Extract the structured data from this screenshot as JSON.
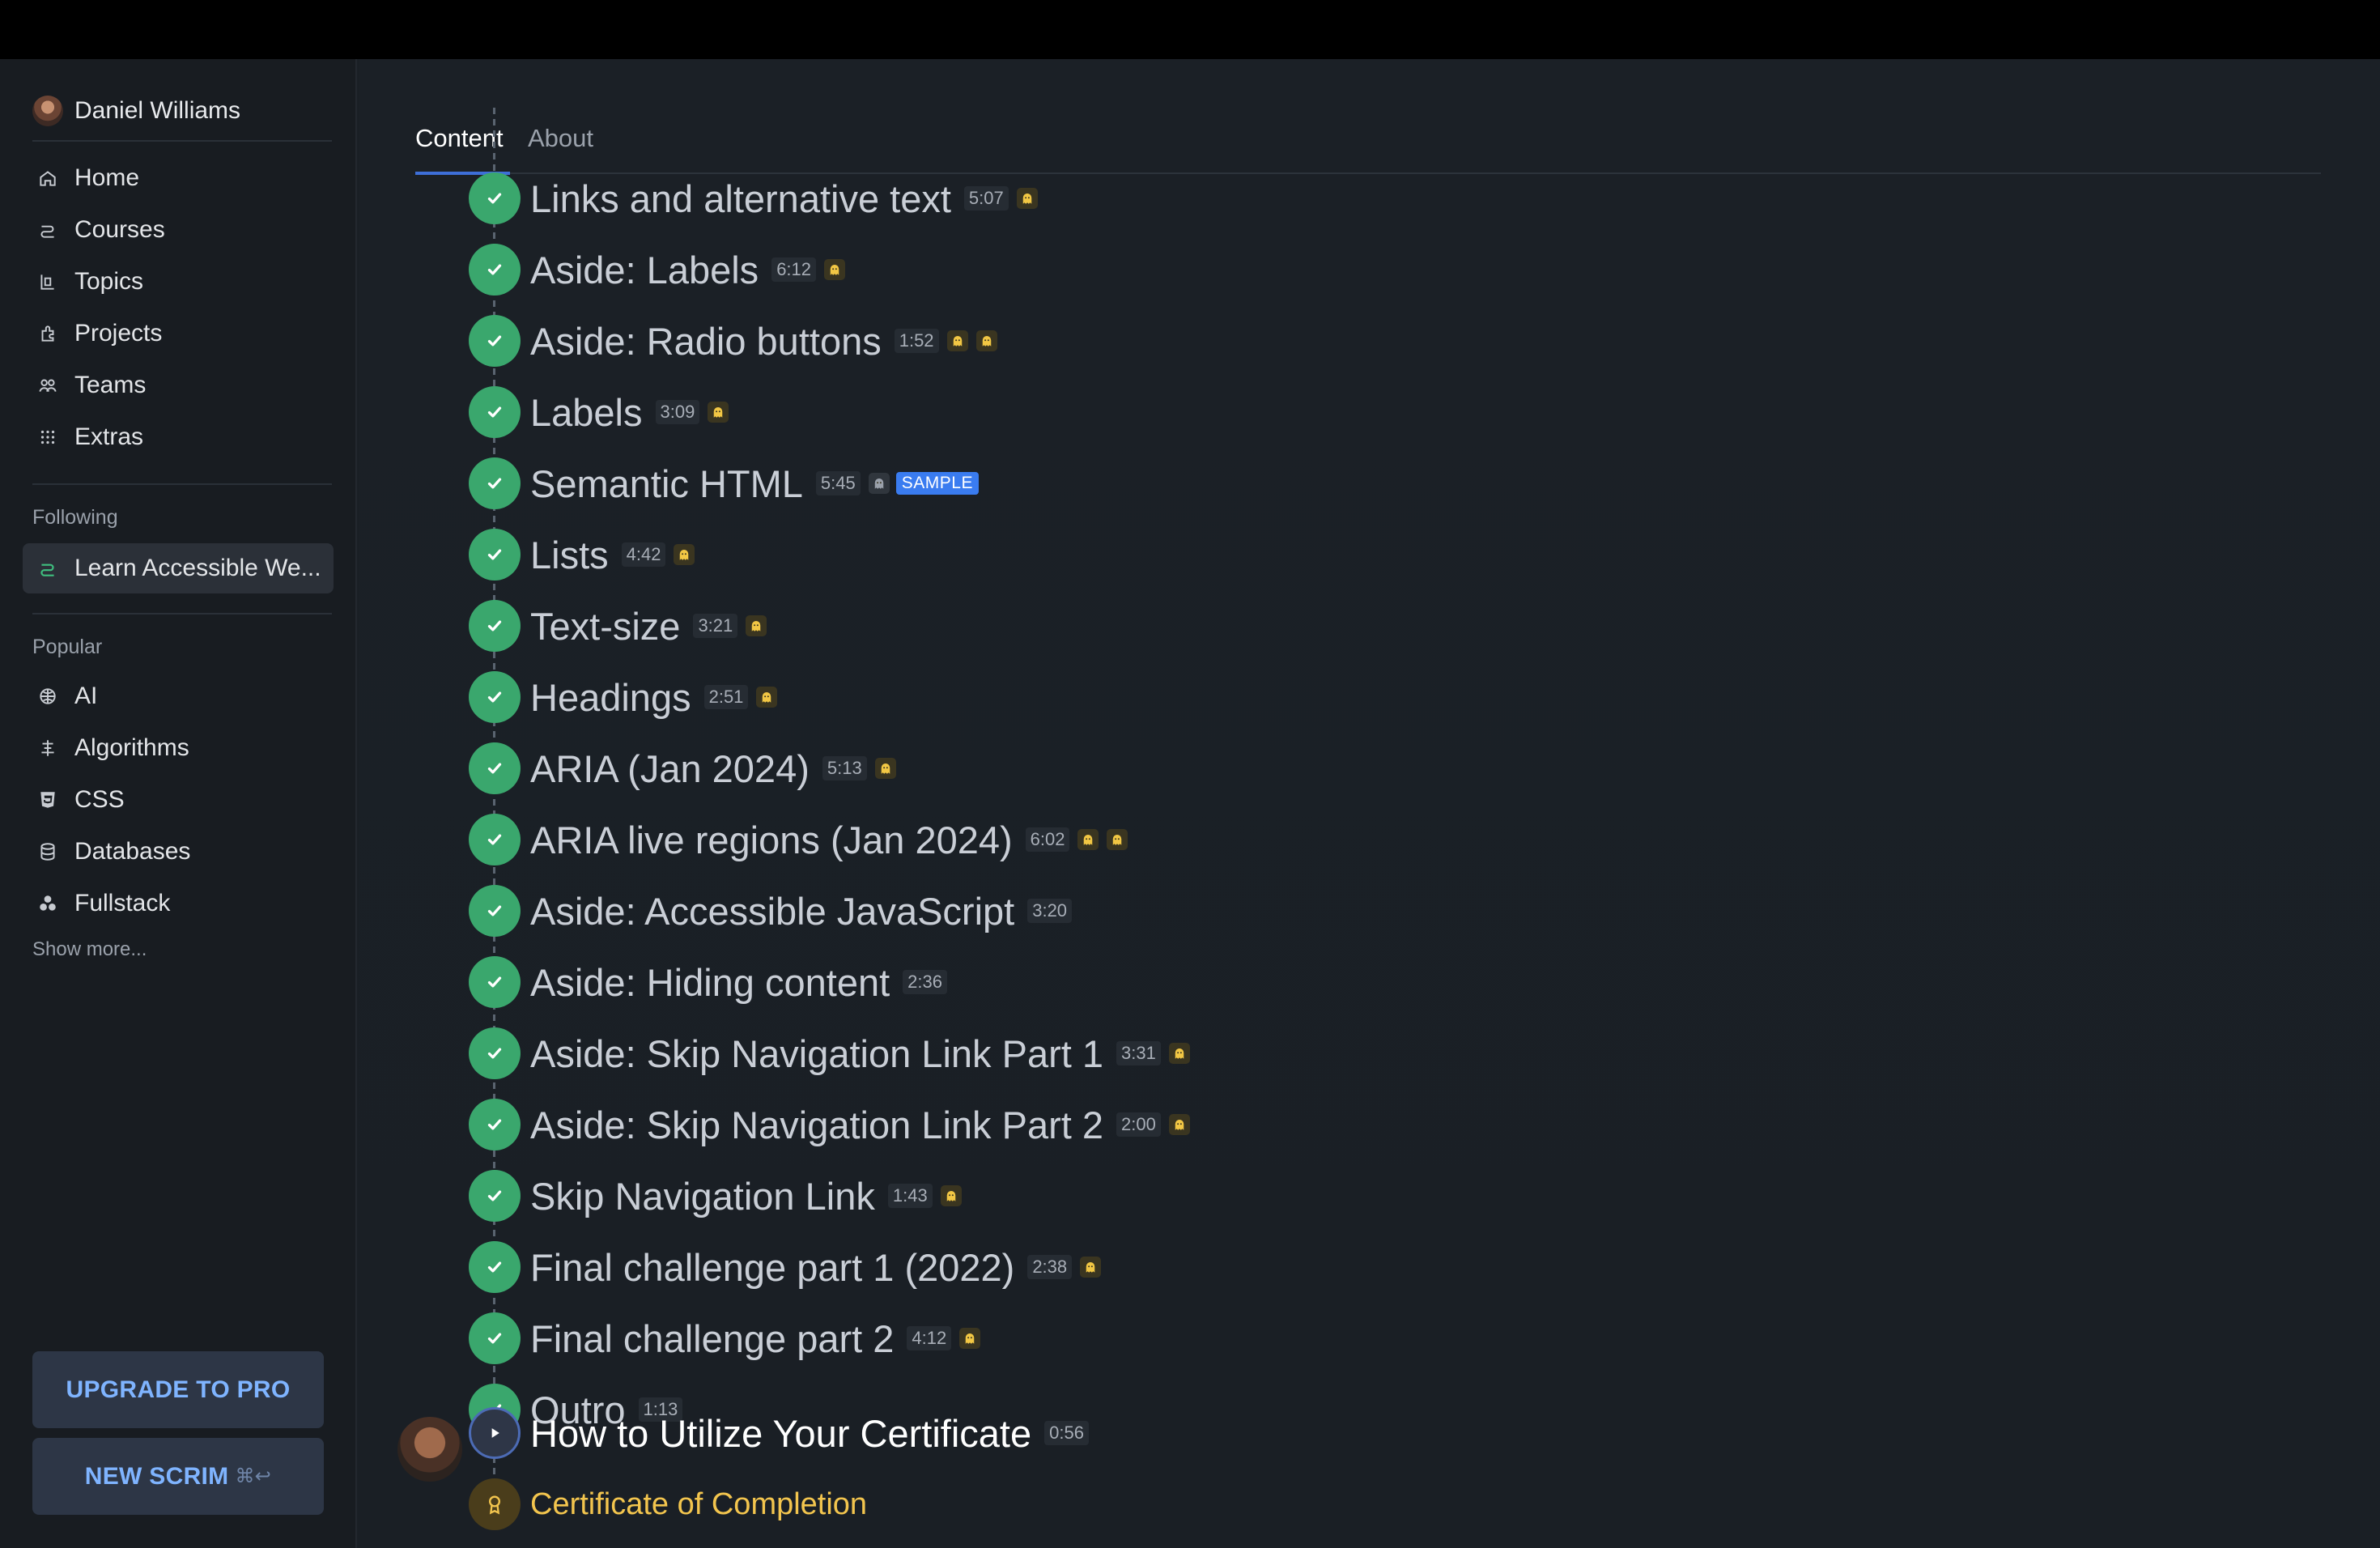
{
  "user": {
    "name": "Daniel Williams"
  },
  "nav": [
    {
      "label": "Home",
      "icon": "home-icon"
    },
    {
      "label": "Courses",
      "icon": "courses-icon"
    },
    {
      "label": "Topics",
      "icon": "topics-icon"
    },
    {
      "label": "Projects",
      "icon": "projects-icon"
    },
    {
      "label": "Teams",
      "icon": "teams-icon"
    },
    {
      "label": "Extras",
      "icon": "extras-icon"
    }
  ],
  "following": {
    "title": "Following",
    "items": [
      {
        "label": "Learn Accessible We...",
        "icon": "course-icon",
        "active": true
      }
    ]
  },
  "popular": {
    "title": "Popular",
    "items": [
      {
        "label": "AI",
        "icon": "brain-icon"
      },
      {
        "label": "Algorithms",
        "icon": "algorithms-icon"
      },
      {
        "label": "CSS",
        "icon": "css-icon"
      },
      {
        "label": "Databases",
        "icon": "database-icon"
      },
      {
        "label": "Fullstack",
        "icon": "fullstack-icon"
      }
    ],
    "show_more": "Show more..."
  },
  "buttons": {
    "upgrade": "UPGRADE TO PRO",
    "new_scrim": "NEW SCRIM",
    "new_scrim_shortcut": "⌘↩"
  },
  "tabs": [
    {
      "label": "Content",
      "active": true
    },
    {
      "label": "About",
      "active": false
    }
  ],
  "lessons": [
    {
      "title": "Links and alternative text",
      "duration": "5:07",
      "ghosts": 1
    },
    {
      "title": "Aside: Labels",
      "duration": "6:12",
      "ghosts": 1
    },
    {
      "title": "Aside: Radio buttons",
      "duration": "1:52",
      "ghosts": 2
    },
    {
      "title": "Labels",
      "duration": "3:09",
      "ghosts": 1
    },
    {
      "title": "Semantic HTML",
      "duration": "5:45",
      "ghosts": 1,
      "badge": "SAMPLE"
    },
    {
      "title": "Lists",
      "duration": "4:42",
      "ghosts": 1
    },
    {
      "title": "Text-size",
      "duration": "3:21",
      "ghosts": 1
    },
    {
      "title": "Headings",
      "duration": "2:51",
      "ghosts": 1
    },
    {
      "title": "ARIA (Jan 2024)",
      "duration": "5:13",
      "ghosts": 1
    },
    {
      "title": "ARIA live regions (Jan 2024)",
      "duration": "6:02",
      "ghosts": 2
    },
    {
      "title": "Aside: Accessible JavaScript",
      "duration": "3:20",
      "ghosts": 0
    },
    {
      "title": "Aside: Hiding content",
      "duration": "2:36",
      "ghosts": 0
    },
    {
      "title": "Aside: Skip Navigation Link Part 1",
      "duration": "3:31",
      "ghosts": 1
    },
    {
      "title": "Aside: Skip Navigation Link Part 2",
      "duration": "2:00",
      "ghosts": 1
    },
    {
      "title": "Skip Navigation Link",
      "duration": "1:43",
      "ghosts": 1
    },
    {
      "title": "Final challenge part 1 (2022)",
      "duration": "2:38",
      "ghosts": 1
    },
    {
      "title": "Final challenge part 2",
      "duration": "4:12",
      "ghosts": 1
    },
    {
      "title": "Outro",
      "duration": "1:13",
      "ghosts": 0
    }
  ],
  "current_lesson": {
    "title": "How to Utilize Your Certificate",
    "duration": "0:56"
  },
  "certificate": {
    "title": "Certificate of Completion"
  },
  "colors": {
    "check": "#3aa76d",
    "accent": "#3e6fd8",
    "certificate": "#f3c54e",
    "pro_button_text": "#7fb4ff"
  }
}
